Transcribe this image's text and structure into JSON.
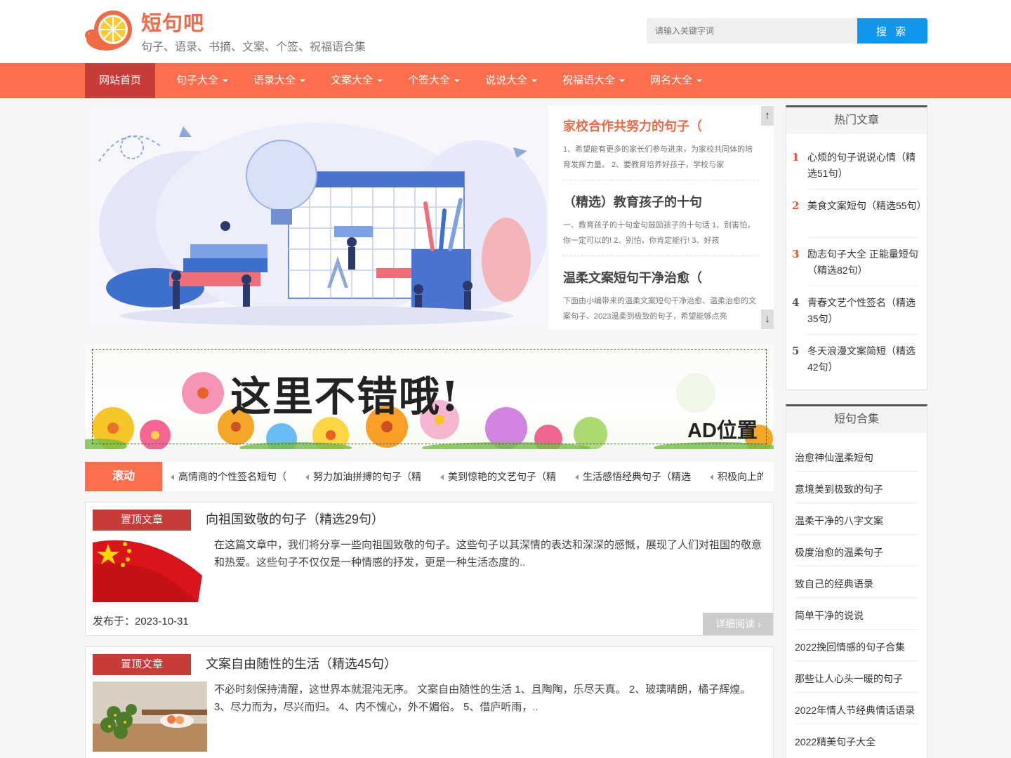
{
  "header": {
    "site_title": "短句吧",
    "site_subtitle": "句子、语录、书摘、文案、个签、祝福语合集",
    "search_placeholder": "请输入关键字词",
    "search_button": "搜 索"
  },
  "nav": {
    "items": [
      {
        "label": "网站首页",
        "active": true
      },
      {
        "label": "句子大全"
      },
      {
        "label": "语录大全"
      },
      {
        "label": "文案大全"
      },
      {
        "label": "个签大全"
      },
      {
        "label": "说说大全"
      },
      {
        "label": "祝福语大全"
      },
      {
        "label": "网名大全"
      }
    ]
  },
  "slider": {
    "items": [
      {
        "title": "家校合作共努力的句子（",
        "text": "1、希望能有更多的家长们参与进来，为家校共同体的培育发挥力量。 2、要教育培养好孩子，学校与家"
      },
      {
        "title": "（精选）教育孩子的十句",
        "text": "一、教育孩子的十句金句鼓励孩子的十句话 1、别害怕，你一定可以的! 2、别怕，你肯定能行! 3、好孩"
      },
      {
        "title": "温柔文案短句干净治愈（",
        "text": "下面由小编带来的温柔文案短句干净治愈、温柔治愈的文案句子、2023温柔到极致的句子，希望能够点亮"
      }
    ],
    "up_arrow": "↑",
    "down_arrow": "↓"
  },
  "ad": {
    "headline": "这里不错哦!",
    "label": "AD位置"
  },
  "ticker": {
    "label": "滚动",
    "items": [
      "高情商的个性签名短句（",
      "努力加油拼搏的句子（精",
      "美到惊艳的文艺句子（精",
      "生活感悟经典句子（精选",
      "积极向上的"
    ]
  },
  "articles": [
    {
      "badge": "置顶文章",
      "title": "向祖国致敬的句子（精选29句）",
      "summary": "在这篇文章中，我们将分享一些向祖国致敬的句子。这些句子以其深情的表达和深深的感慨，展现了人们对祖国的敬意和热爱。这些句子不仅仅是一种情感的抒发，更是一种生活态度的..",
      "date": "发布于：2023-10-31",
      "more": "详细阅读 ›"
    },
    {
      "badge": "置顶文章",
      "title": "文案自由随性的生活（精选45句）",
      "summary": "不必时刻保持清醒，这世界本就混沌无序。 文案自由随性的生活 1、且陶陶，乐尽天真。 2、玻璃晴朗，橘子辉煌。 3、尽力而为，尽兴而归。 4、内不愧心，外不媚俗。 5、借庐听雨，.."
    }
  ],
  "sidebar": {
    "hot": {
      "heading": "热门文章",
      "items": [
        {
          "rank": "1",
          "title": "心烦的句子说说心情（精选51句）",
          "color": "#e8533a"
        },
        {
          "rank": "2",
          "title": "美食文案短句（精选55句）",
          "color": "#e8533a"
        },
        {
          "rank": "3",
          "title": "励志句子大全 正能量短句（精选82句）",
          "color": "#e8533a"
        },
        {
          "rank": "4",
          "title": "青春文艺个性签名（精选35句）",
          "color": "#555555"
        },
        {
          "rank": "5",
          "title": "冬天浪漫文案简短（精选42句）",
          "color": "#555555"
        }
      ]
    },
    "collection": {
      "heading": "短句合集",
      "items": [
        "治愈神仙温柔短句",
        "意境美到极致的句子",
        "温柔干净的八字文案",
        "极度治愈的温柔句子",
        "致自己的经典语录",
        "简单干净的说说",
        "2022挽回情感的句子合集",
        "那些让人心头一暖的句子",
        "2022年情人节经典情话语录",
        "2022精美句子大全"
      ]
    }
  },
  "colors": {
    "brand": "#f06a45",
    "nav_bg": "#fd6f4c",
    "nav_active": "#c83c38",
    "search_button": "#1196ee"
  }
}
